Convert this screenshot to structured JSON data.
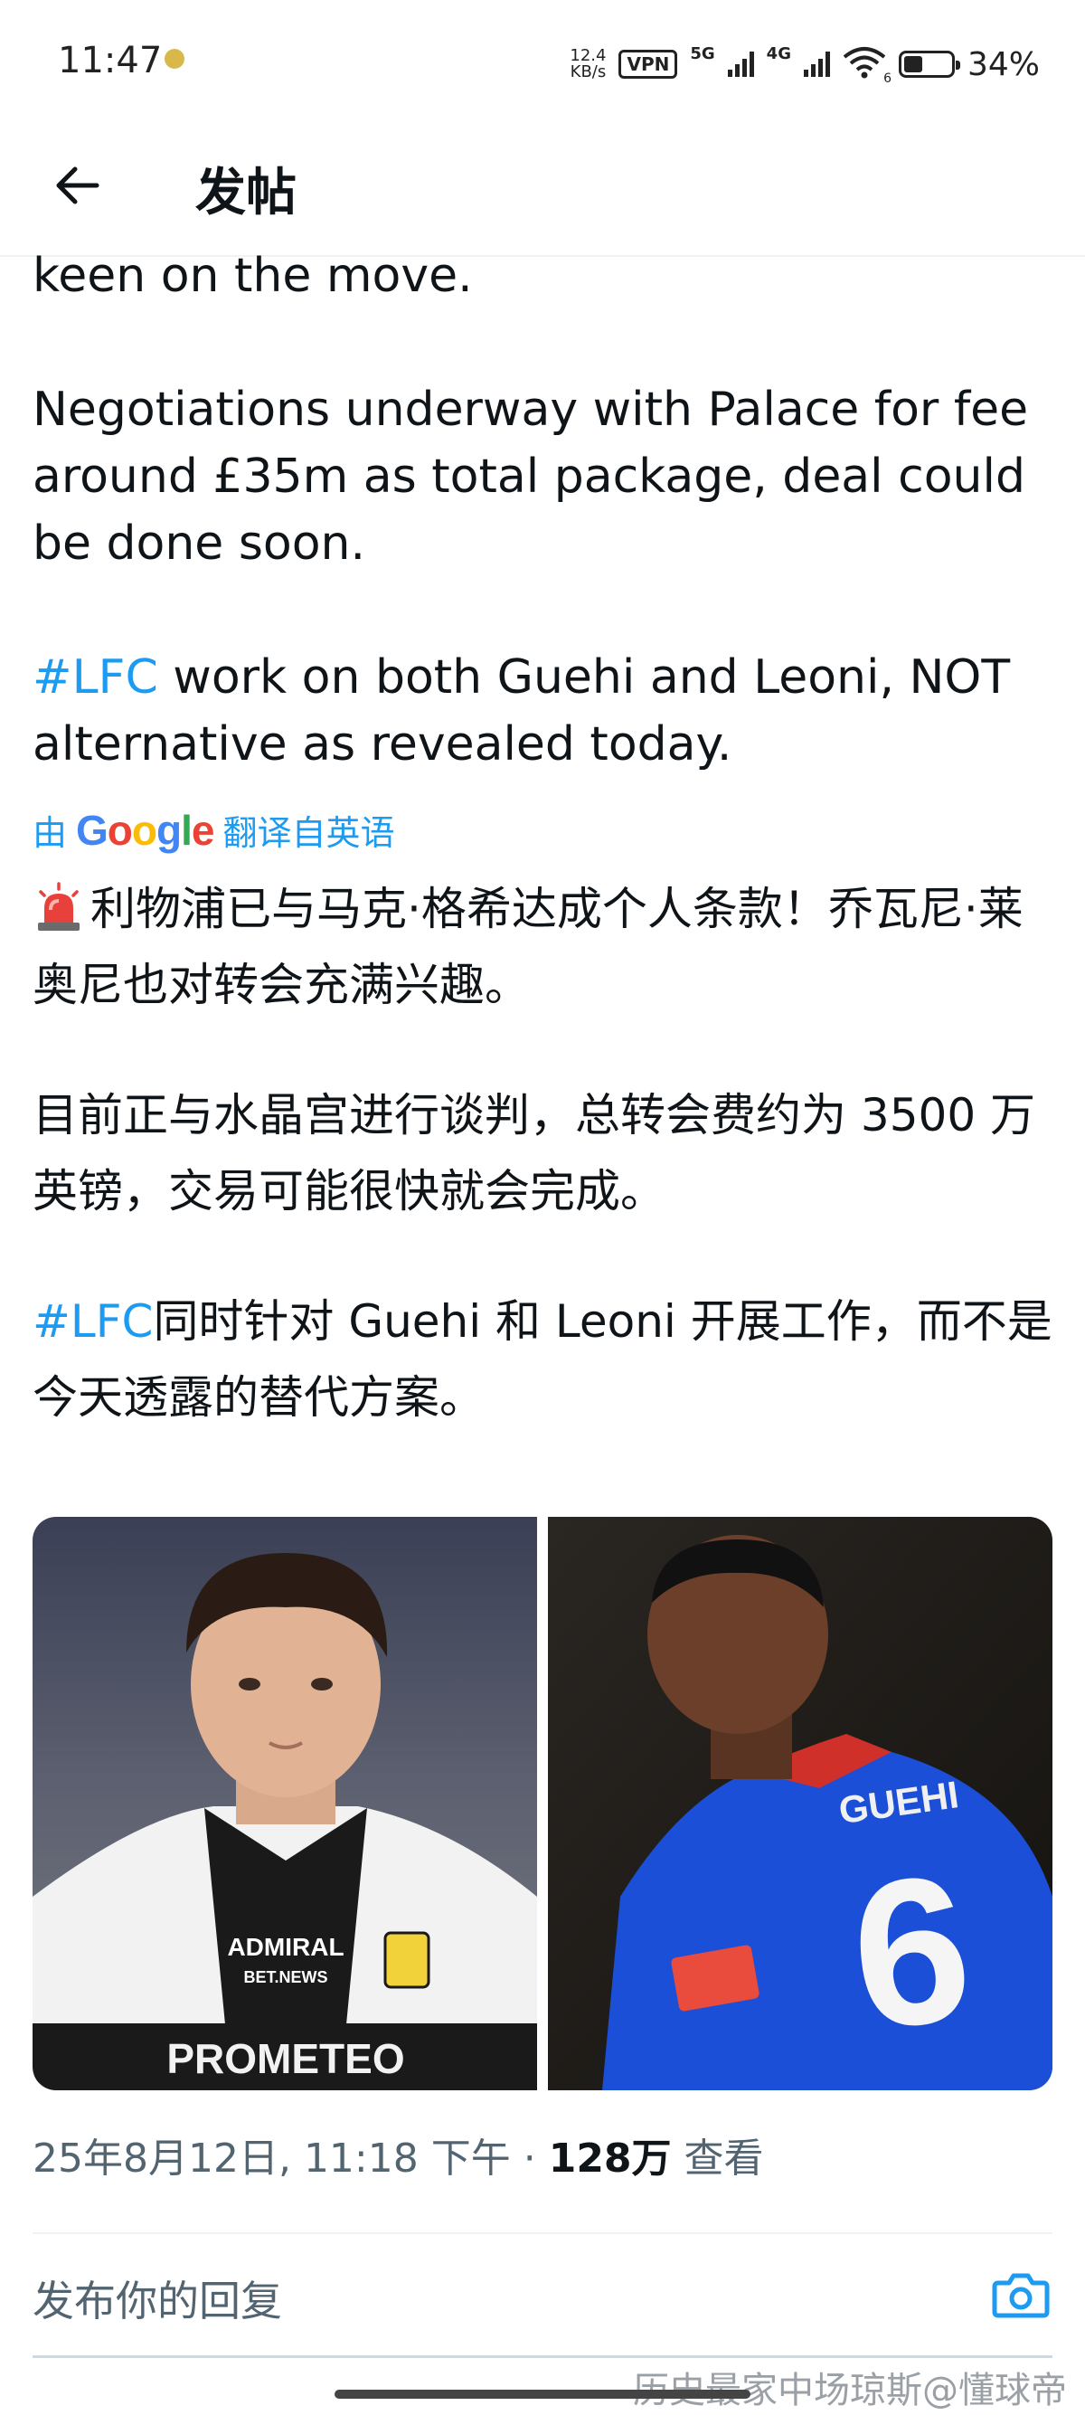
{
  "status_bar": {
    "time": "11:47",
    "net_speed_value": "12.4",
    "net_speed_unit": "KB/s",
    "vpn": "VPN",
    "sim1": "5G",
    "sim2": "4G",
    "wifi_label": "6",
    "battery": "34%",
    "battery_level": 0.34,
    "icons": [
      "app-notification-icon",
      "vpn-icon",
      "signal-icon",
      "wifi-icon",
      "battery-icon"
    ]
  },
  "header": {
    "back_icon": "arrow-left-icon",
    "title": "发帖"
  },
  "post": {
    "english": {
      "partial_line": "keen on the move.",
      "para2": "Negotiations underway with Palace for fee around £35m as total package, deal could be done soon.",
      "hashtag": "#LFC",
      "para3_rest": " work on both Guehi and Leoni, NOT alternative as revealed today."
    },
    "translation": {
      "prefix": "由",
      "brand": "Google",
      "suffix": "翻译自英语",
      "siren_icon": "siren-icon",
      "para1": "利物浦已与马克·格希达成个人条款！乔瓦尼·莱奥尼也对转会充满兴趣。",
      "para2": "目前正与水晶宫进行谈判，总转会费约为 3500 万英镑，交易可能很快就会完成。",
      "hashtag": "#LFC",
      "para3_rest": "同时针对 Guehi 和 Leoni 开展工作，而不是今天透露的替代方案。"
    },
    "media": {
      "images": [
        "player-leoni-photo",
        "player-guehi-photo"
      ],
      "left_sponsor": "ADMIRAL",
      "left_sponsor_sub": "BET.NEWS",
      "left_shirt_text": "PROMETEO",
      "right_name": "GUEHI",
      "right_number": "6"
    },
    "meta": {
      "date_time": "25年8月12日, 11:18 下午 · ",
      "views_count": "128万",
      "views_label": " 查看"
    }
  },
  "reply": {
    "placeholder": "发布你的回复",
    "camera_icon": "camera-icon"
  },
  "watermark": "历史最家中场琼斯@懂球帝",
  "colors": {
    "link_blue": "#1d9bf0",
    "text": "#0f1419",
    "secondary": "#536471"
  }
}
